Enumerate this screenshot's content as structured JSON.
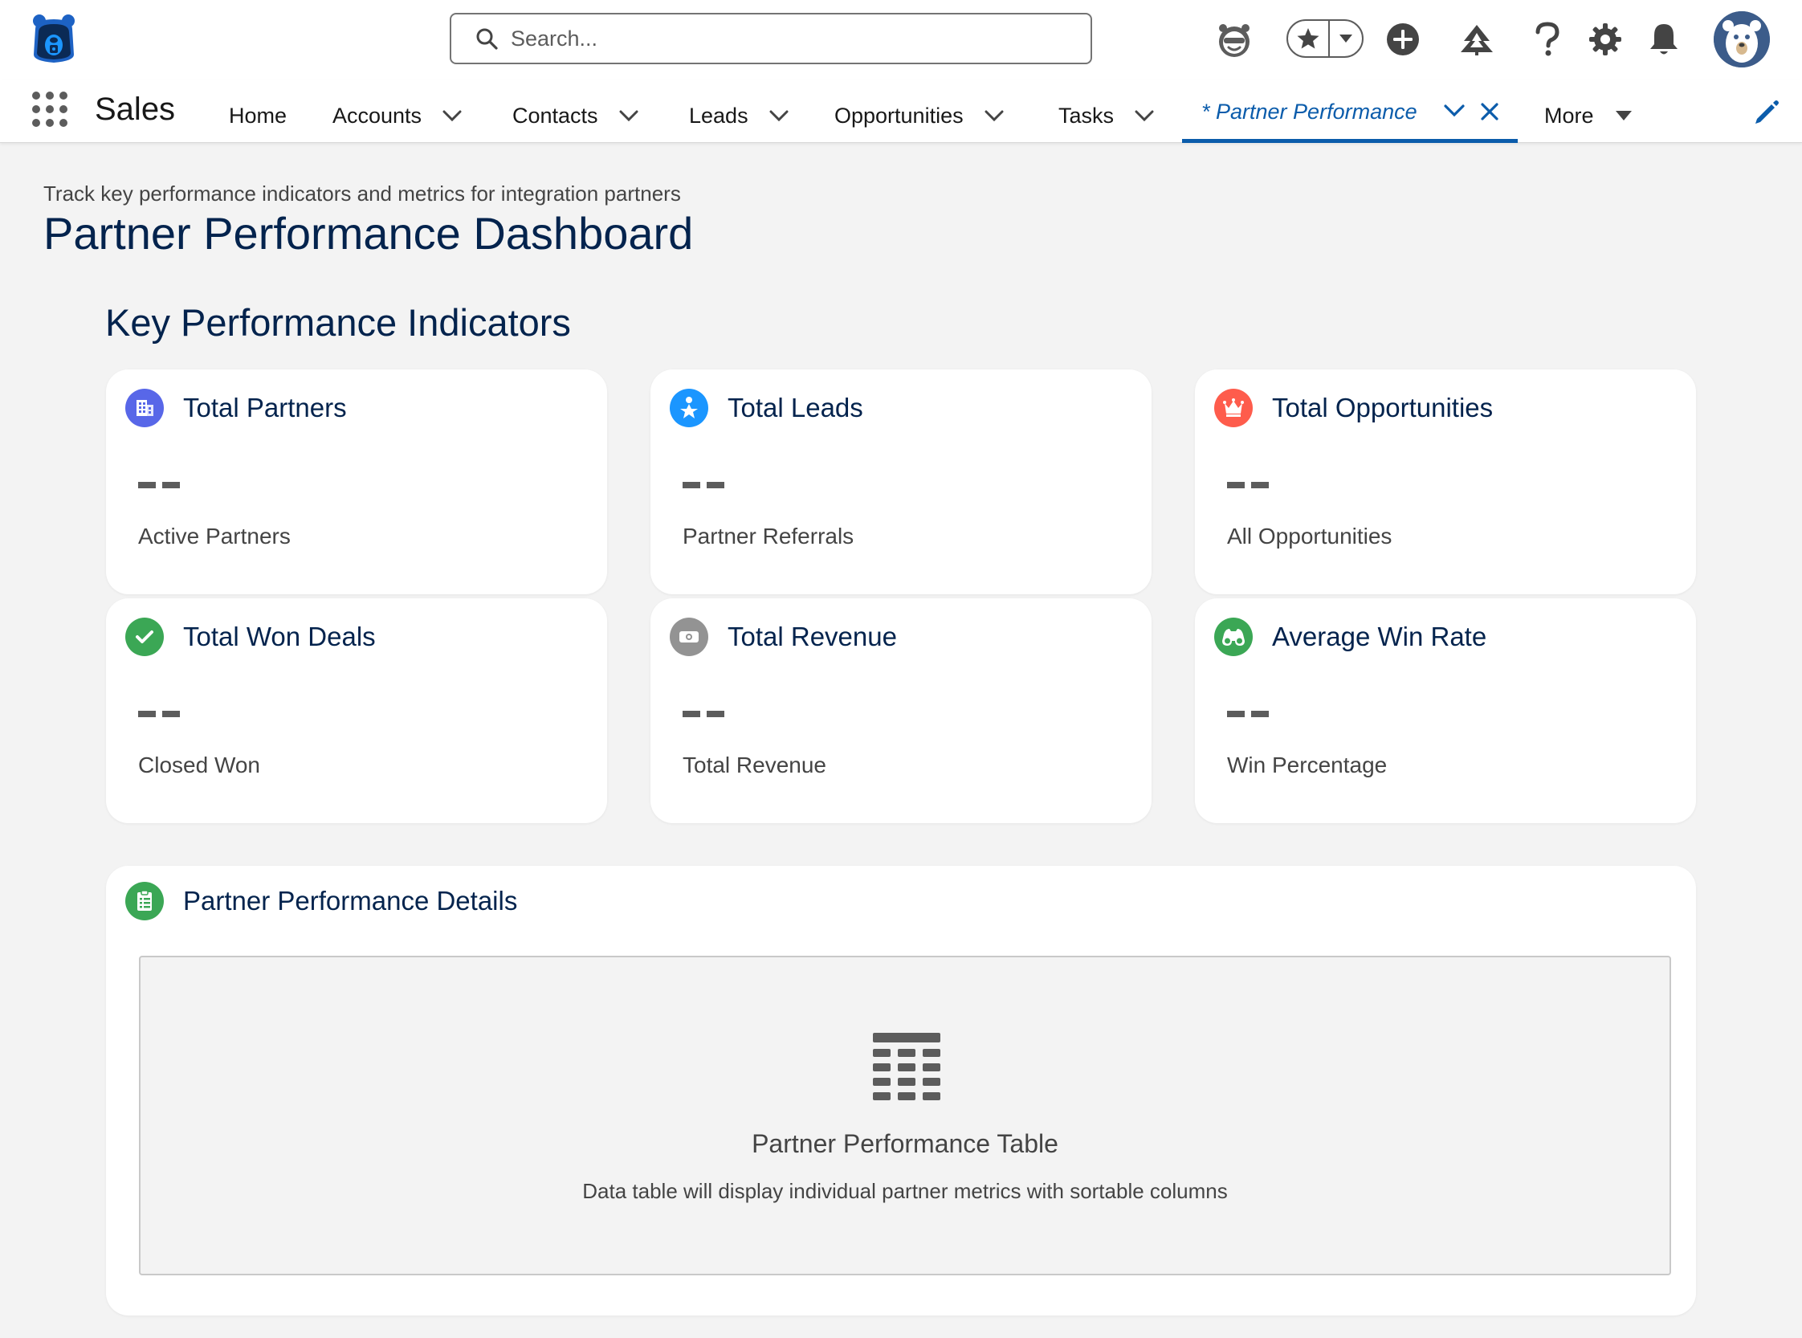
{
  "header": {
    "search_placeholder": "Search...",
    "icons": [
      "bear-logo-icon",
      "einstein-icon",
      "favorites-star-icon",
      "favorites-menu-icon",
      "global-create-icon",
      "trailhead-icon",
      "help-icon",
      "setup-gear-icon",
      "notifications-bell-icon",
      "user-avatar"
    ]
  },
  "nav": {
    "app_name": "Sales",
    "items": [
      {
        "label": "Home",
        "has_menu": false
      },
      {
        "label": "Accounts",
        "has_menu": true
      },
      {
        "label": "Contacts",
        "has_menu": true
      },
      {
        "label": "Leads",
        "has_menu": true
      },
      {
        "label": "Opportunities",
        "has_menu": true
      },
      {
        "label": "Tasks",
        "has_menu": true
      }
    ],
    "active_tab": {
      "label": "* Partner Performance"
    },
    "more_label": "More",
    "accent_color": "#0b5cab"
  },
  "page": {
    "subtitle": "Track key performance indicators and metrics for integration partners",
    "title": "Partner Performance Dashboard"
  },
  "kpi_section": {
    "title": "Key Performance Indicators",
    "cards": [
      {
        "title": "Total Partners",
        "value": "--",
        "label": "Active Partners",
        "icon": "building-icon",
        "icon_color": "#5867e8"
      },
      {
        "title": "Total Leads",
        "value": "--",
        "label": "Partner Referrals",
        "icon": "person-star-icon",
        "icon_color": "#1b96ff"
      },
      {
        "title": "Total Opportunities",
        "value": "--",
        "label": "All Opportunities",
        "icon": "crown-icon",
        "icon_color": "#fe5c4c"
      },
      {
        "title": "Total Won Deals",
        "value": "--",
        "label": "Closed Won",
        "icon": "check-icon",
        "icon_color": "#3ba755"
      },
      {
        "title": "Total Revenue",
        "value": "--",
        "label": "Total Revenue",
        "icon": "money-icon",
        "icon_color": "#939393"
      },
      {
        "title": "Average Win Rate",
        "value": "--",
        "label": "Win Percentage",
        "icon": "binoculars-icon",
        "icon_color": "#3ba755"
      }
    ]
  },
  "details": {
    "title": "Partner Performance Details",
    "icon": "clipboard-icon",
    "placeholder_title": "Partner Performance Table",
    "placeholder_desc": "Data table will display individual partner metrics with sortable columns"
  }
}
